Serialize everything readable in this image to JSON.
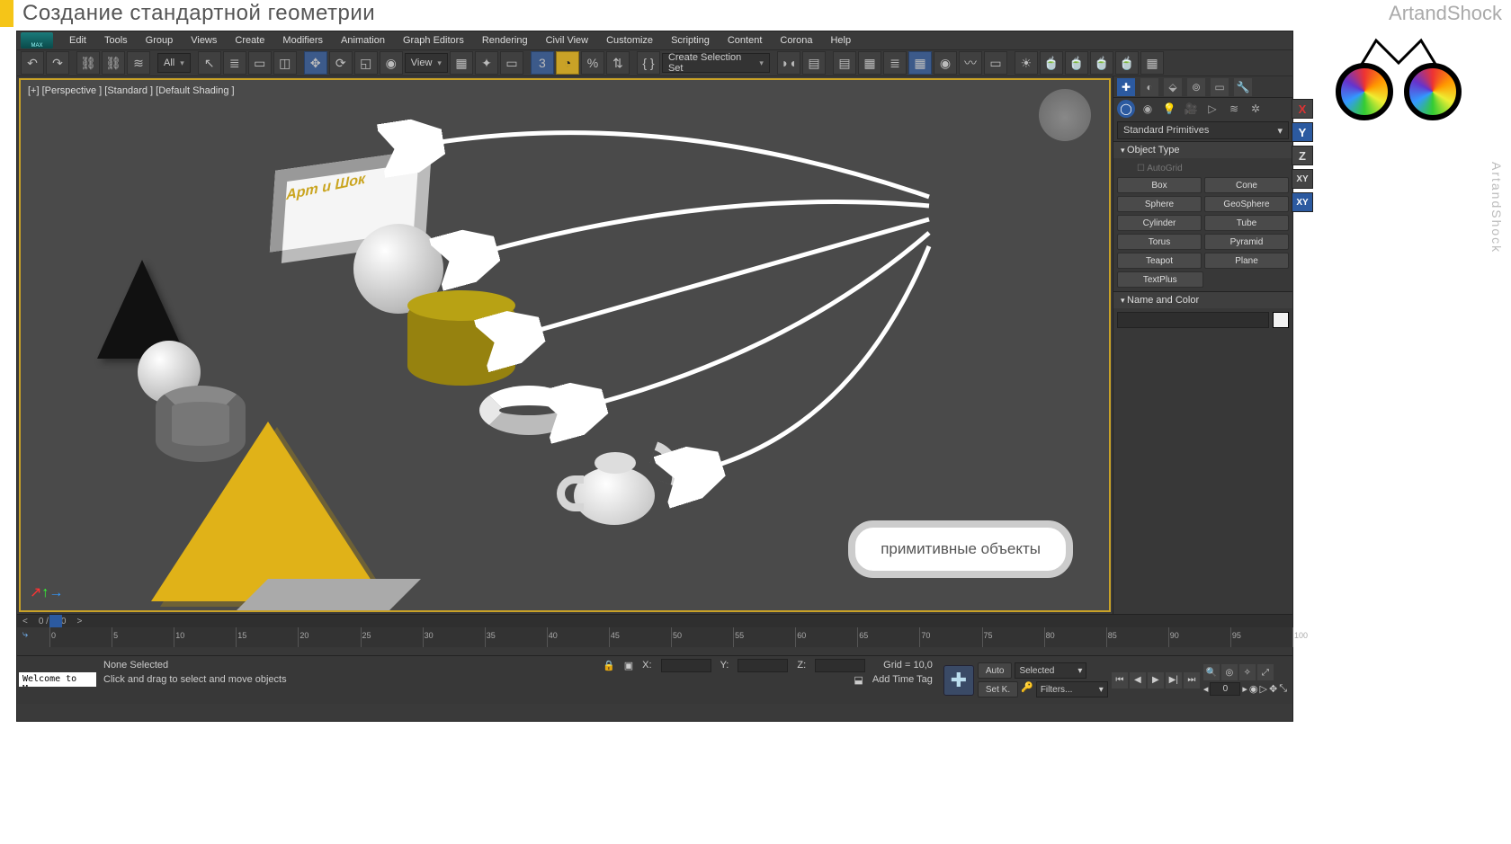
{
  "header": {
    "title": "Создание стандартной геометрии",
    "brand": "ArtandShock",
    "brand_vertical": "ArtandShock"
  },
  "menu": [
    "Edit",
    "Tools",
    "Group",
    "Views",
    "Create",
    "Modifiers",
    "Animation",
    "Graph Editors",
    "Rendering",
    "Civil View",
    "Customize",
    "Scripting",
    "Content",
    "Corona",
    "Help"
  ],
  "app_logo": "MAX",
  "toolbar": {
    "filter_combo": "All",
    "view_combo": "View",
    "selection_set": "Create Selection Set"
  },
  "viewport": {
    "label": "[+] [Perspective ] [Standard ] [Default Shading ]",
    "box_text": "Арт и Шок",
    "caption": "примитивные объекты"
  },
  "gizmo": {
    "x": "X",
    "y": "Y",
    "z": "Z",
    "xy": "XY",
    "xya": "XY"
  },
  "create_panel": {
    "dropdown": "Standard Primitives",
    "rollout1": "Object Type",
    "autogrid": "AutoGrid",
    "buttons": [
      "Box",
      "Cone",
      "Sphere",
      "GeoSphere",
      "Cylinder",
      "Tube",
      "Torus",
      "Pyramid",
      "Teapot",
      "Plane",
      "TextPlus"
    ],
    "rollout2": "Name and Color"
  },
  "timeline": {
    "range": "0 / 100",
    "ticks": [
      "0",
      "5",
      "10",
      "15",
      "20",
      "25",
      "30",
      "35",
      "40",
      "45",
      "50",
      "55",
      "60",
      "65",
      "70",
      "75",
      "80",
      "85",
      "90",
      "95",
      "100"
    ]
  },
  "status": {
    "welcome": "Welcome to M:",
    "none_selected": "None Selected",
    "hint": "Click and drag to select and move objects",
    "x": "X:",
    "y": "Y:",
    "z": "Z:",
    "grid": "Grid = 10,0",
    "add_time_tag": "Add Time Tag",
    "auto": "Auto",
    "setk": "Set K.",
    "selected": "Selected",
    "filters": "Filters...",
    "frame": "0"
  }
}
